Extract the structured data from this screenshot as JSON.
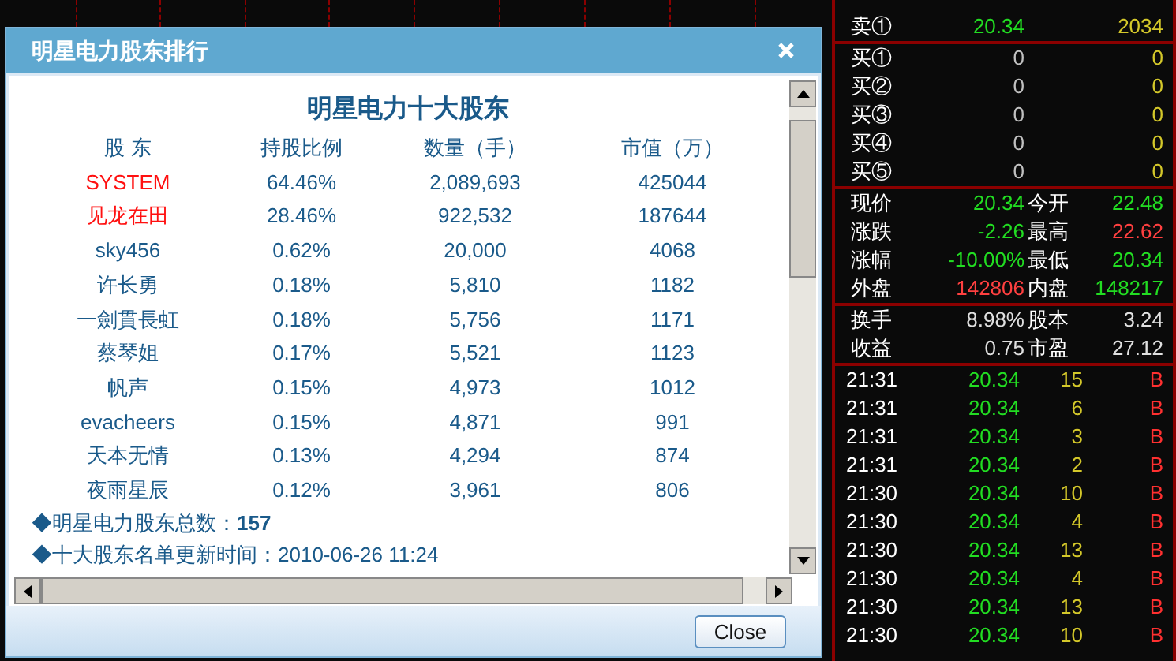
{
  "dialog": {
    "title": "明星电力股东排行",
    "heading": "明星电力十大股东",
    "columns": [
      "股 东",
      "持股比例",
      "数量（手）",
      "市值（万）"
    ],
    "rows": [
      {
        "name": "SYSTEM",
        "highlighted": true,
        "ratio": "64.46%",
        "quantity": "2,089,693",
        "value": "425044"
      },
      {
        "name": "见龙在田",
        "highlighted": true,
        "ratio": "28.46%",
        "quantity": "922,532",
        "value": "187644"
      },
      {
        "name": "sky456",
        "highlighted": false,
        "ratio": "0.62%",
        "quantity": "20,000",
        "value": "4068"
      },
      {
        "name": "许长勇",
        "highlighted": false,
        "ratio": "0.18%",
        "quantity": "5,810",
        "value": "1182"
      },
      {
        "name": "一劍貫長虹",
        "highlighted": false,
        "ratio": "0.18%",
        "quantity": "5,756",
        "value": "1171"
      },
      {
        "name": "蔡琴姐",
        "highlighted": false,
        "ratio": "0.17%",
        "quantity": "5,521",
        "value": "1123"
      },
      {
        "name": "帆声",
        "highlighted": false,
        "ratio": "0.15%",
        "quantity": "4,973",
        "value": "1012"
      },
      {
        "name": "evacheers",
        "highlighted": false,
        "ratio": "0.15%",
        "quantity": "4,871",
        "value": "991"
      },
      {
        "name": "天本无情",
        "highlighted": false,
        "ratio": "0.13%",
        "quantity": "4,294",
        "value": "874"
      },
      {
        "name": "夜雨星辰",
        "highlighted": false,
        "ratio": "0.12%",
        "quantity": "3,961",
        "value": "806"
      }
    ],
    "notes": [
      "◆明星电力股东总数：**157**",
      "◆十大股东名单更新时间：2010-06-26 11:24"
    ],
    "close_button": "Close"
  },
  "order_book": {
    "sells": [
      {
        "label": "卖①",
        "price": "20.34",
        "volume": "2034"
      }
    ],
    "buys": [
      {
        "label": "买①",
        "price": "0",
        "volume": "0"
      },
      {
        "label": "买②",
        "price": "0",
        "volume": "0"
      },
      {
        "label": "买③",
        "price": "0",
        "volume": "0"
      },
      {
        "label": "买④",
        "price": "0",
        "volume": "0"
      },
      {
        "label": "买⑤",
        "price": "0",
        "volume": "0"
      }
    ]
  },
  "quote": [
    [
      {
        "label": "现价",
        "value": "20.34",
        "color": "#22dd22"
      },
      {
        "label": "今开",
        "value": "22.48",
        "color": "#22dd22"
      }
    ],
    [
      {
        "label": "涨跌",
        "value": "-2.26",
        "color": "#22dd22"
      },
      {
        "label": "最高",
        "value": "22.62",
        "color": "#ff4040"
      }
    ],
    [
      {
        "label": "涨幅",
        "value": "-10.00%",
        "color": "#22dd22"
      },
      {
        "label": "最低",
        "value": "20.34",
        "color": "#22dd22"
      }
    ],
    [
      {
        "label": "外盘",
        "value": "142806",
        "color": "#ff4040"
      },
      {
        "label": "内盘",
        "value": "148217",
        "color": "#22dd22"
      }
    ]
  ],
  "stats": [
    [
      {
        "label": "换手",
        "value": "8.98%"
      },
      {
        "label": "股本",
        "value": "3.24"
      }
    ],
    [
      {
        "label": "收益",
        "value": "0.75"
      },
      {
        "label": "市盈",
        "value": "27.12"
      }
    ]
  ],
  "trades": [
    {
      "time": "21:31",
      "price": "20.34",
      "volume": "15",
      "side": "B"
    },
    {
      "time": "21:31",
      "price": "20.34",
      "volume": "6",
      "side": "B"
    },
    {
      "time": "21:31",
      "price": "20.34",
      "volume": "3",
      "side": "B"
    },
    {
      "time": "21:31",
      "price": "20.34",
      "volume": "2",
      "side": "B"
    },
    {
      "time": "21:30",
      "price": "20.34",
      "volume": "10",
      "side": "B"
    },
    {
      "time": "21:30",
      "price": "20.34",
      "volume": "4",
      "side": "B"
    },
    {
      "time": "21:30",
      "price": "20.34",
      "volume": "13",
      "side": "B"
    },
    {
      "time": "21:30",
      "price": "20.34",
      "volume": "4",
      "side": "B"
    },
    {
      "time": "21:30",
      "price": "20.34",
      "volume": "13",
      "side": "B"
    },
    {
      "time": "21:30",
      "price": "20.34",
      "volume": "10",
      "side": "B"
    }
  ]
}
